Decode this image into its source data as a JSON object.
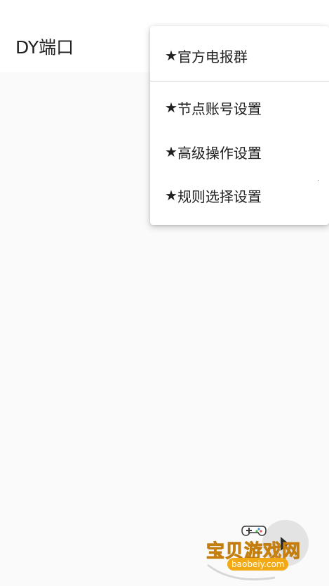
{
  "app_bar": {
    "title": "DY端口"
  },
  "menu": {
    "items": [
      {
        "icon": "star-icon",
        "star": "★",
        "label": "官方电报群"
      },
      {
        "icon": "star-icon",
        "star": "★",
        "label": "节点账号设置"
      },
      {
        "icon": "star-icon",
        "star": "★",
        "label": "高级操作设置"
      },
      {
        "icon": "star-icon",
        "star": "★",
        "label": "规则选择设置"
      }
    ]
  },
  "watermark": {
    "brand": "宝贝游戏网",
    "site": "baobeiy.com"
  },
  "colors": {
    "background": "#fafafa",
    "app_bar": "#ffffff",
    "text": "#212121",
    "watermark_orange": "#f6b52b"
  }
}
